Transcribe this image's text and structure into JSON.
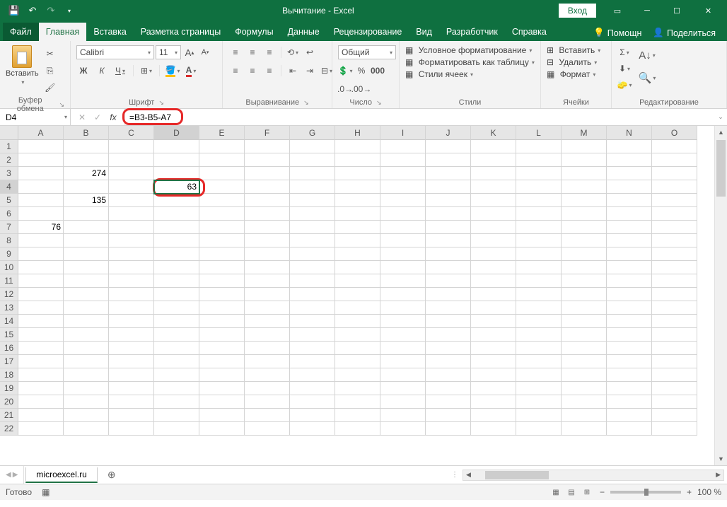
{
  "titlebar": {
    "title": "Вычитание - Excel",
    "login": "Вход"
  },
  "tabs": {
    "file": "Файл",
    "home": "Главная",
    "insert": "Вставка",
    "pagelayout": "Разметка страницы",
    "formulas": "Формулы",
    "data": "Данные",
    "review": "Рецензирование",
    "view": "Вид",
    "developer": "Разработчик",
    "help": "Справка",
    "tellme": "Помощн",
    "share": "Поделиться"
  },
  "ribbon": {
    "clipboard": {
      "label": "Буфер обмена",
      "paste": "Вставить"
    },
    "font": {
      "label": "Шрифт",
      "name": "Calibri",
      "size": "11",
      "bold": "Ж",
      "italic": "К",
      "underline": "Ч"
    },
    "alignment": {
      "label": "Выравнивание"
    },
    "number": {
      "label": "Число",
      "format": "Общий"
    },
    "styles": {
      "label": "Стили",
      "cond": "Условное форматирование",
      "table": "Форматировать как таблицу",
      "cell": "Стили ячеек"
    },
    "cells": {
      "label": "Ячейки",
      "insert": "Вставить",
      "delete": "Удалить",
      "format": "Формат"
    },
    "editing": {
      "label": "Редактирование"
    }
  },
  "formula_bar": {
    "cell_ref": "D4",
    "fx": "fx",
    "formula": "=B3-B5-A7"
  },
  "grid": {
    "columns": [
      "A",
      "B",
      "C",
      "D",
      "E",
      "F",
      "G",
      "H",
      "I",
      "J",
      "K",
      "L",
      "M",
      "N",
      "O"
    ],
    "rows": 22,
    "cells": {
      "B3": "274",
      "D4": "63",
      "B5": "135",
      "A7": "76"
    },
    "active": "D4"
  },
  "sheet": {
    "name": "microexcel.ru"
  },
  "status": {
    "ready": "Готово",
    "zoom": "100 %"
  }
}
